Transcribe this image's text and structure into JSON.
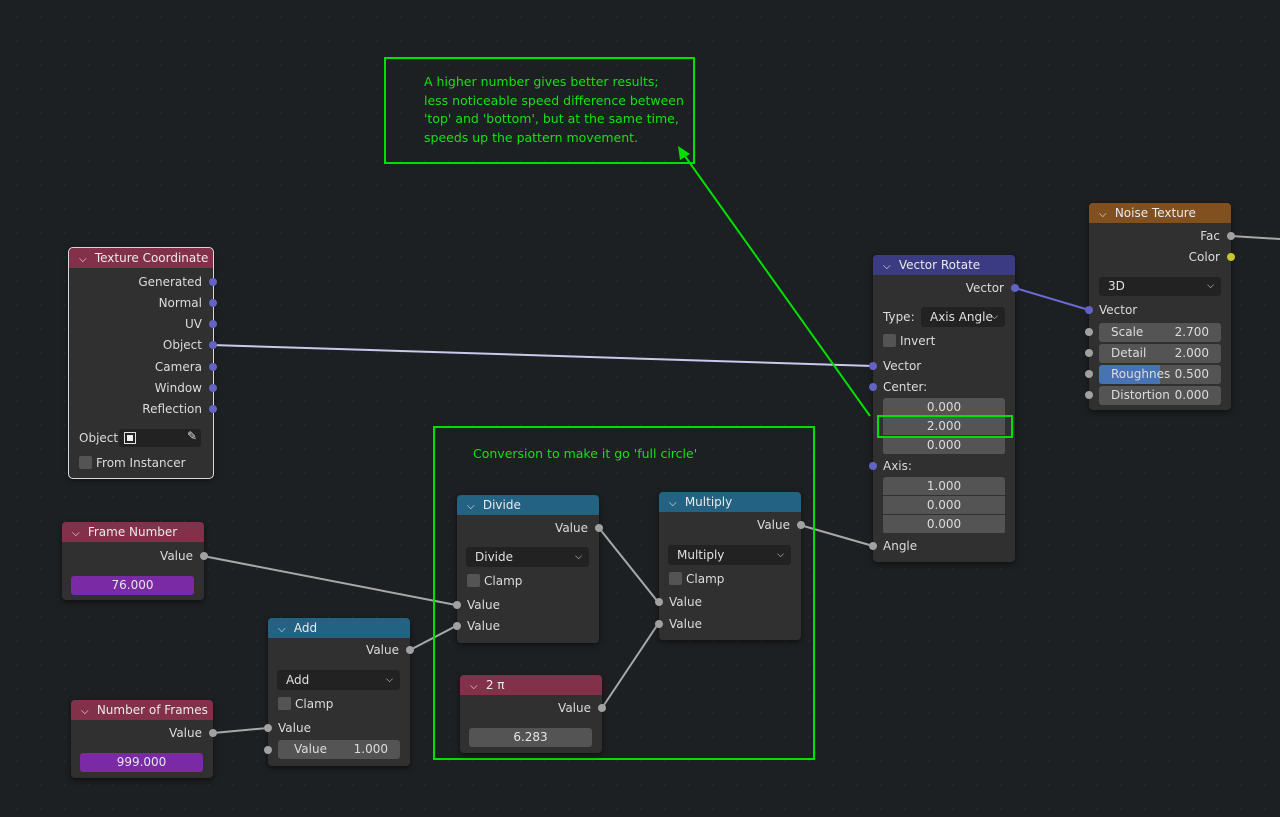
{
  "annotations": {
    "note_lines": [
      "A higher number gives better results;",
      "less noticeable speed difference between",
      "'top' and 'bottom', but at the same time,",
      "speeds up the pattern movement."
    ],
    "frame_label": "Conversion to make it go 'full circle'",
    "annotation_color": "#00e000"
  },
  "texture_coordinate": {
    "title": "Texture Coordinate",
    "outputs": [
      "Generated",
      "Normal",
      "UV",
      "Object",
      "Camera",
      "Window",
      "Reflection"
    ],
    "object_label": "Object:",
    "from_instancer": "From Instancer",
    "header_color": "#83314a"
  },
  "frame_number": {
    "title": "Frame Number",
    "output": "Value",
    "value": "76.000"
  },
  "number_of_frames": {
    "title": "Number of Frames",
    "output": "Value",
    "value": "999.000"
  },
  "add": {
    "title": "Add",
    "output": "Value",
    "operation": "Add",
    "clamp": "Clamp",
    "input1": "Value",
    "input2_label": "Value",
    "input2_value": "1.000"
  },
  "divide": {
    "title": "Divide",
    "output": "Value",
    "operation": "Divide",
    "clamp": "Clamp",
    "input1": "Value",
    "input2": "Value"
  },
  "multiply": {
    "title": "Multiply",
    "output": "Value",
    "operation": "Multiply",
    "clamp": "Clamp",
    "input1": "Value",
    "input2": "Value"
  },
  "two_pi": {
    "title": "2 π",
    "output": "Value",
    "value": "6.283"
  },
  "vector_rotate": {
    "title": "Vector Rotate",
    "output": "Vector",
    "type_label": "Type:",
    "type_value": "Axis Angle",
    "invert": "Invert",
    "vector_in": "Vector",
    "center_label": "Center:",
    "center": [
      "0.000",
      "2.000",
      "0.000"
    ],
    "axis_label": "Axis:",
    "axis": [
      "1.000",
      "0.000",
      "0.000"
    ],
    "angle": "Angle"
  },
  "noise_texture": {
    "title": "Noise Texture",
    "out_fac": "Fac",
    "out_color": "Color",
    "dimensions": "3D",
    "vector_in": "Vector",
    "fields": [
      {
        "label": "Scale",
        "value": "2.700"
      },
      {
        "label": "Detail",
        "value": "2.000"
      },
      {
        "label": "Roughnes",
        "value": "0.500"
      },
      {
        "label": "Distortion",
        "value": "0.000"
      }
    ],
    "roughness_fraction": 0.5
  }
}
